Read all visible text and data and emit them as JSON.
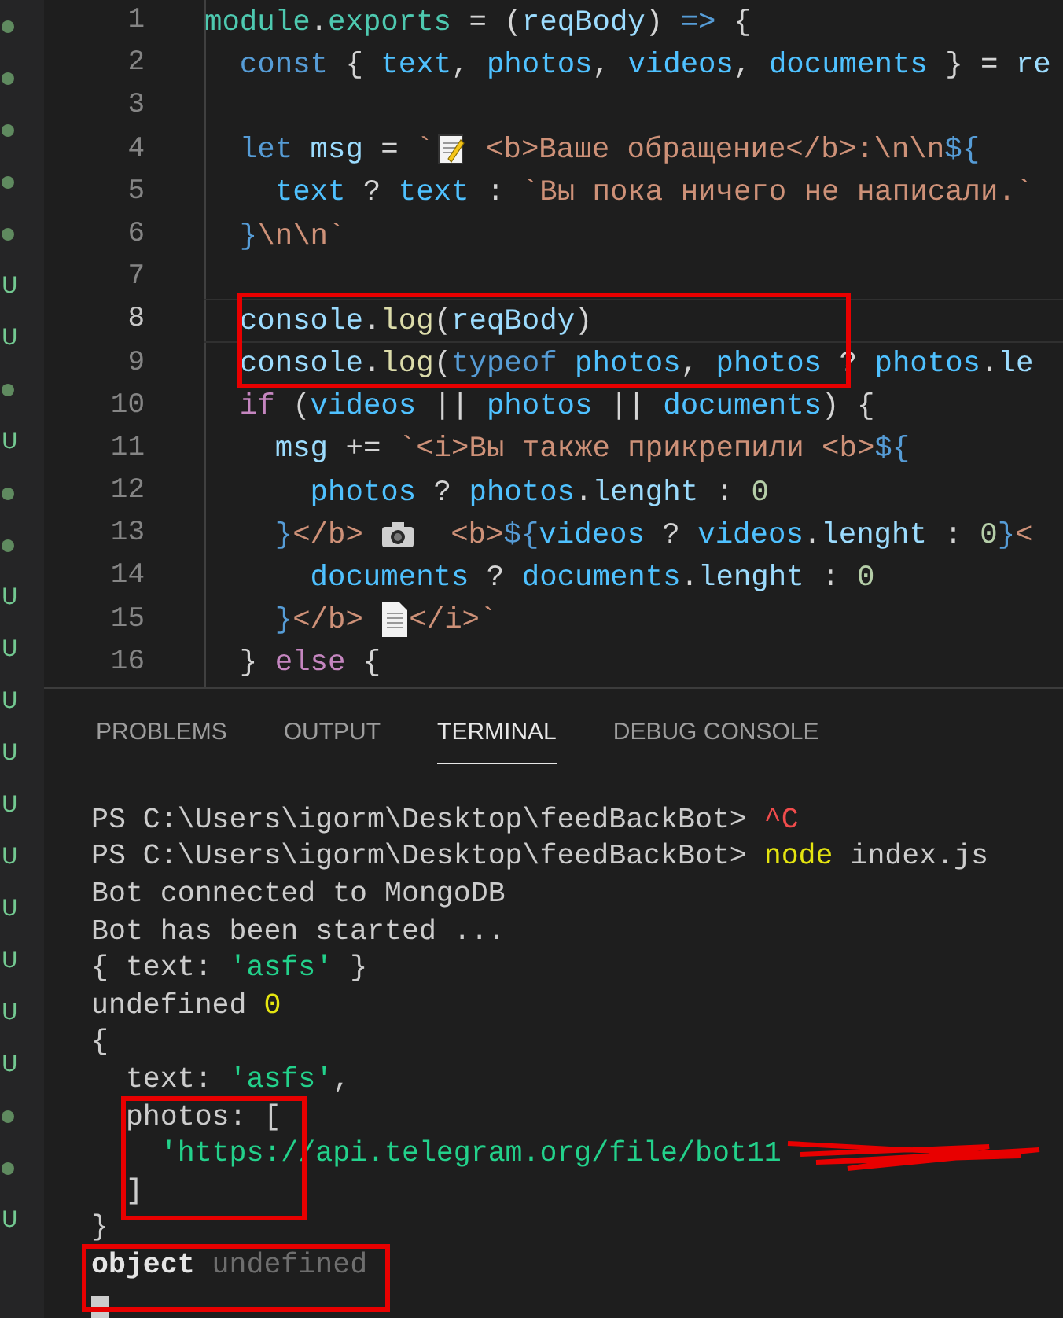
{
  "sidebar_marks": [
    {
      "kind": "dot"
    },
    {
      "kind": "dot"
    },
    {
      "kind": "dot"
    },
    {
      "kind": "dot"
    },
    {
      "kind": "dot"
    },
    {
      "kind": "letter",
      "text": "U"
    },
    {
      "kind": "letter",
      "text": "U"
    },
    {
      "kind": "dot"
    },
    {
      "kind": "letter",
      "text": "U"
    },
    {
      "kind": "dot"
    },
    {
      "kind": "dot"
    },
    {
      "kind": "letter",
      "text": "U"
    },
    {
      "kind": "letter",
      "text": "U"
    },
    {
      "kind": "letter",
      "text": "U"
    },
    {
      "kind": "letter",
      "text": "U"
    },
    {
      "kind": "letter",
      "text": "U"
    },
    {
      "kind": "letter",
      "text": "U"
    },
    {
      "kind": "letter",
      "text": "U"
    },
    {
      "kind": "letter",
      "text": "U"
    },
    {
      "kind": "letter",
      "text": "U"
    },
    {
      "kind": "letter",
      "text": "U"
    },
    {
      "kind": "dot"
    },
    {
      "kind": "dot"
    },
    {
      "kind": "letter",
      "text": "U"
    }
  ],
  "editor": {
    "lines": [
      {
        "number": "1",
        "current": false,
        "boxed": false,
        "tokens": [
          {
            "kind": "teal",
            "text": "module"
          },
          {
            "kind": "punct",
            "text": "."
          },
          {
            "kind": "teal",
            "text": "exports"
          },
          {
            "kind": "punct",
            "text": " = ("
          },
          {
            "kind": "var",
            "text": "reqBody"
          },
          {
            "kind": "punct",
            "text": ") "
          },
          {
            "kind": "kw",
            "text": "=>"
          },
          {
            "kind": "punct",
            "text": " {"
          }
        ]
      },
      {
        "number": "2",
        "current": false,
        "boxed": false,
        "tokens": [
          {
            "kind": "kw",
            "text": "  const"
          },
          {
            "kind": "punct",
            "text": " { "
          },
          {
            "kind": "cvar",
            "text": "text"
          },
          {
            "kind": "punct",
            "text": ", "
          },
          {
            "kind": "cvar",
            "text": "photos"
          },
          {
            "kind": "punct",
            "text": ", "
          },
          {
            "kind": "cvar",
            "text": "videos"
          },
          {
            "kind": "punct",
            "text": ", "
          },
          {
            "kind": "cvar",
            "text": "documents"
          },
          {
            "kind": "punct",
            "text": " } = "
          },
          {
            "kind": "var",
            "text": "re"
          }
        ]
      },
      {
        "number": "3",
        "current": false,
        "boxed": false
      },
      {
        "number": "4",
        "current": false,
        "boxed": false,
        "tokens": [
          {
            "kind": "kw",
            "text": "  let"
          },
          {
            "kind": "var",
            "text": " msg"
          },
          {
            "kind": "punct",
            "text": " = "
          },
          {
            "kind": "str",
            "text": "`"
          },
          {
            "kind": "memo"
          },
          {
            "kind": "str",
            "text": " <b>Ваше обращение</b>:\\n\\n"
          },
          {
            "kind": "kw",
            "text": "${"
          }
        ]
      },
      {
        "number": "5",
        "current": false,
        "boxed": false,
        "tokens": [
          {
            "kind": "cvar",
            "text": "    text"
          },
          {
            "kind": "punct",
            "text": " ? "
          },
          {
            "kind": "cvar",
            "text": "text"
          },
          {
            "kind": "punct",
            "text": " : "
          },
          {
            "kind": "str",
            "text": "`Вы пока ничего не написали.`"
          }
        ]
      },
      {
        "number": "6",
        "current": false,
        "boxed": false,
        "tokens": [
          {
            "kind": "kw",
            "text": "  }"
          },
          {
            "kind": "str",
            "text": "\\n\\n`"
          }
        ]
      },
      {
        "number": "7",
        "current": false,
        "boxed": false
      },
      {
        "number": "8",
        "current": true,
        "boxed": true,
        "tokens": [
          {
            "kind": "var",
            "text": "  console"
          },
          {
            "kind": "punct",
            "text": "."
          },
          {
            "kind": "fn",
            "text": "log"
          },
          {
            "kind": "punct",
            "text": "("
          },
          {
            "kind": "var",
            "text": "reqBody"
          },
          {
            "kind": "punct",
            "text": ")"
          }
        ]
      },
      {
        "number": "9",
        "current": false,
        "boxed": true,
        "tokens": [
          {
            "kind": "var",
            "text": "  console"
          },
          {
            "kind": "punct",
            "text": "."
          },
          {
            "kind": "fn",
            "text": "log"
          },
          {
            "kind": "punct",
            "text": "("
          },
          {
            "kind": "kw",
            "text": "typeof"
          },
          {
            "kind": "cvar",
            "text": " photos"
          },
          {
            "kind": "punct",
            "text": ", "
          },
          {
            "kind": "cvar",
            "text": "photos"
          },
          {
            "kind": "punct",
            "text": " ? "
          },
          {
            "kind": "cvar",
            "text": "photos"
          },
          {
            "kind": "punct",
            "text": "."
          },
          {
            "kind": "var",
            "text": "le"
          }
        ]
      },
      {
        "number": "10",
        "current": false,
        "boxed": false,
        "tokens": [
          {
            "kind": "ctrl",
            "text": "  if"
          },
          {
            "kind": "punct",
            "text": " ("
          },
          {
            "kind": "cvar",
            "text": "videos"
          },
          {
            "kind": "punct",
            "text": " || "
          },
          {
            "kind": "cvar",
            "text": "photos"
          },
          {
            "kind": "punct",
            "text": " || "
          },
          {
            "kind": "cvar",
            "text": "documents"
          },
          {
            "kind": "punct",
            "text": ") {"
          }
        ]
      },
      {
        "number": "11",
        "current": false,
        "boxed": false,
        "tokens": [
          {
            "kind": "var",
            "text": "    msg"
          },
          {
            "kind": "punct",
            "text": " += "
          },
          {
            "kind": "str",
            "text": "`<i>Вы также прикрепили <b>"
          },
          {
            "kind": "kw",
            "text": "${"
          }
        ]
      },
      {
        "number": "12",
        "current": false,
        "boxed": false,
        "tokens": [
          {
            "kind": "cvar",
            "text": "      photos"
          },
          {
            "kind": "punct",
            "text": " ? "
          },
          {
            "kind": "cvar",
            "text": "photos"
          },
          {
            "kind": "punct",
            "text": "."
          },
          {
            "kind": "var",
            "text": "lenght"
          },
          {
            "kind": "punct",
            "text": " : "
          },
          {
            "kind": "num",
            "text": "0"
          }
        ]
      },
      {
        "number": "13",
        "current": false,
        "boxed": false,
        "tokens": [
          {
            "kind": "kw",
            "text": "    }"
          },
          {
            "kind": "str",
            "text": "</b> "
          },
          {
            "kind": "camera"
          },
          {
            "kind": "str",
            "text": "  <b>"
          },
          {
            "kind": "kw",
            "text": "${"
          },
          {
            "kind": "cvar",
            "text": "videos"
          },
          {
            "kind": "punct",
            "text": " ? "
          },
          {
            "kind": "cvar",
            "text": "videos"
          },
          {
            "kind": "punct",
            "text": "."
          },
          {
            "kind": "var",
            "text": "lenght"
          },
          {
            "kind": "punct",
            "text": " : "
          },
          {
            "kind": "num",
            "text": "0"
          },
          {
            "kind": "kw",
            "text": "}"
          },
          {
            "kind": "str",
            "text": "<"
          }
        ]
      },
      {
        "number": "14",
        "current": false,
        "boxed": false,
        "tokens": [
          {
            "kind": "cvar",
            "text": "      documents"
          },
          {
            "kind": "punct",
            "text": " ? "
          },
          {
            "kind": "cvar",
            "text": "documents"
          },
          {
            "kind": "punct",
            "text": "."
          },
          {
            "kind": "var",
            "text": "lenght"
          },
          {
            "kind": "punct",
            "text": " : "
          },
          {
            "kind": "num",
            "text": "0"
          }
        ]
      },
      {
        "number": "15",
        "current": false,
        "boxed": false,
        "tokens": [
          {
            "kind": "kw",
            "text": "    }"
          },
          {
            "kind": "str",
            "text": "</b> "
          },
          {
            "kind": "document"
          },
          {
            "kind": "str",
            "text": "</i>`"
          }
        ]
      },
      {
        "number": "16",
        "current": false,
        "boxed": false,
        "tokens": [
          {
            "kind": "punct",
            "text": "  } "
          },
          {
            "kind": "ctrl",
            "text": "else"
          },
          {
            "kind": "punct",
            "text": " {"
          }
        ]
      }
    ]
  },
  "panel": {
    "tabs": [
      {
        "label": "PROBLEMS",
        "selected": false
      },
      {
        "label": "OUTPUT",
        "selected": false
      },
      {
        "label": "TERMINAL",
        "selected": true
      },
      {
        "label": "DEBUG CONSOLE",
        "selected": false
      }
    ],
    "terminal": [
      {
        "boxed": false,
        "tokens": [
          {
            "kind": "plain",
            "text": "PS C:\\Users\\igorm\\Desktop\\feedBackBot> "
          },
          {
            "kind": "red",
            "text": "^C"
          }
        ]
      },
      {
        "boxed": false,
        "tokens": [
          {
            "kind": "plain",
            "text": "PS C:\\Users\\igorm\\Desktop\\feedBackBot> "
          },
          {
            "kind": "yellow",
            "text": "node"
          },
          {
            "kind": "plain",
            "text": " index.js"
          }
        ]
      },
      {
        "boxed": false,
        "tokens": [
          {
            "kind": "plain",
            "text": "Bot connected to MongoDB"
          }
        ]
      },
      {
        "boxed": false,
        "tokens": [
          {
            "kind": "plain",
            "text": "Bot has been started ..."
          }
        ]
      },
      {
        "boxed": false,
        "tokens": [
          {
            "kind": "plain",
            "text": "{ text: "
          },
          {
            "kind": "green",
            "text": "'asfs'"
          },
          {
            "kind": "plain",
            "text": " }"
          }
        ]
      },
      {
        "boxed": false,
        "tokens": [
          {
            "kind": "plain",
            "text": "undefined "
          },
          {
            "kind": "yellow",
            "text": "0"
          }
        ]
      },
      {
        "boxed": false,
        "tokens": [
          {
            "kind": "plain",
            "text": "{"
          }
        ]
      },
      {
        "boxed": false,
        "tokens": [
          {
            "kind": "plain",
            "text": "  text: "
          },
          {
            "kind": "green",
            "text": "'asfs'"
          },
          {
            "kind": "plain",
            "text": ","
          }
        ]
      },
      {
        "boxed": true,
        "tokens": [
          {
            "kind": "plain",
            "text": "  photos: ["
          }
        ]
      },
      {
        "boxed": true,
        "tokens": [
          {
            "kind": "green",
            "text": "    'https://api.telegram.org/file/bot11"
          },
          {
            "kind": "redacted"
          }
        ]
      },
      {
        "boxed": true,
        "tokens": [
          {
            "kind": "plain",
            "text": "  ]"
          }
        ]
      },
      {
        "boxed": false,
        "tokens": [
          {
            "kind": "plain",
            "text": "}"
          }
        ]
      },
      {
        "boxed": true,
        "tokens": [
          {
            "kind": "bold",
            "text": "object"
          },
          {
            "kind": "dim",
            "text": " undefined"
          }
        ]
      },
      {
        "boxed": true,
        "tokens": [
          {
            "kind": "cursor"
          }
        ]
      }
    ]
  }
}
